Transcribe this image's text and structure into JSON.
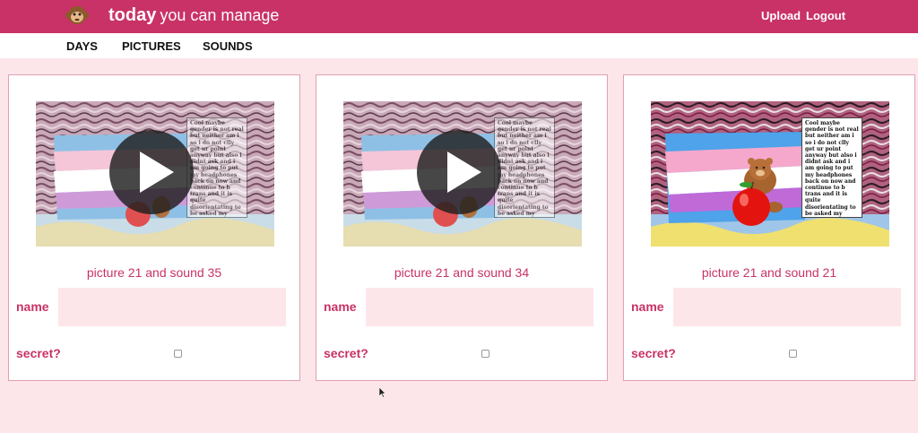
{
  "header": {
    "brand_bold": "today",
    "brand_rest": "you can manage",
    "upload_label": "Upload",
    "logout_label": "Logout"
  },
  "nav": {
    "items": [
      {
        "label": "DAYS"
      },
      {
        "label": "PICTURES"
      },
      {
        "label": "SOUNDS"
      }
    ]
  },
  "poem_text": "Cool maybe gender is not real but neither am i so i do not clly get ur point anyway but also i didnt ask and i am going to put my headphones back on now and continue to b trans and it is quite disorientating to be asked my opinion on whether my reality is real",
  "cards": [
    {
      "caption": "picture 21 and sound 35",
      "name_label": "name",
      "name_value": "",
      "secret_label": "secret?",
      "has_play": true
    },
    {
      "caption": "picture 21 and sound 34",
      "name_label": "name",
      "name_value": "",
      "secret_label": "secret?",
      "has_play": true
    },
    {
      "caption": "picture 21 and sound 21",
      "name_label": "name",
      "name_value": "",
      "secret_label": "secret?",
      "has_play": false
    }
  ],
  "colors": {
    "brand": "#c93266",
    "page_bg": "#fde6ea",
    "field_bg": "#fde6ea"
  },
  "icons": {
    "logo": "monkey-icon",
    "play": "play-icon",
    "cursor": "mouse-pointer-icon"
  }
}
